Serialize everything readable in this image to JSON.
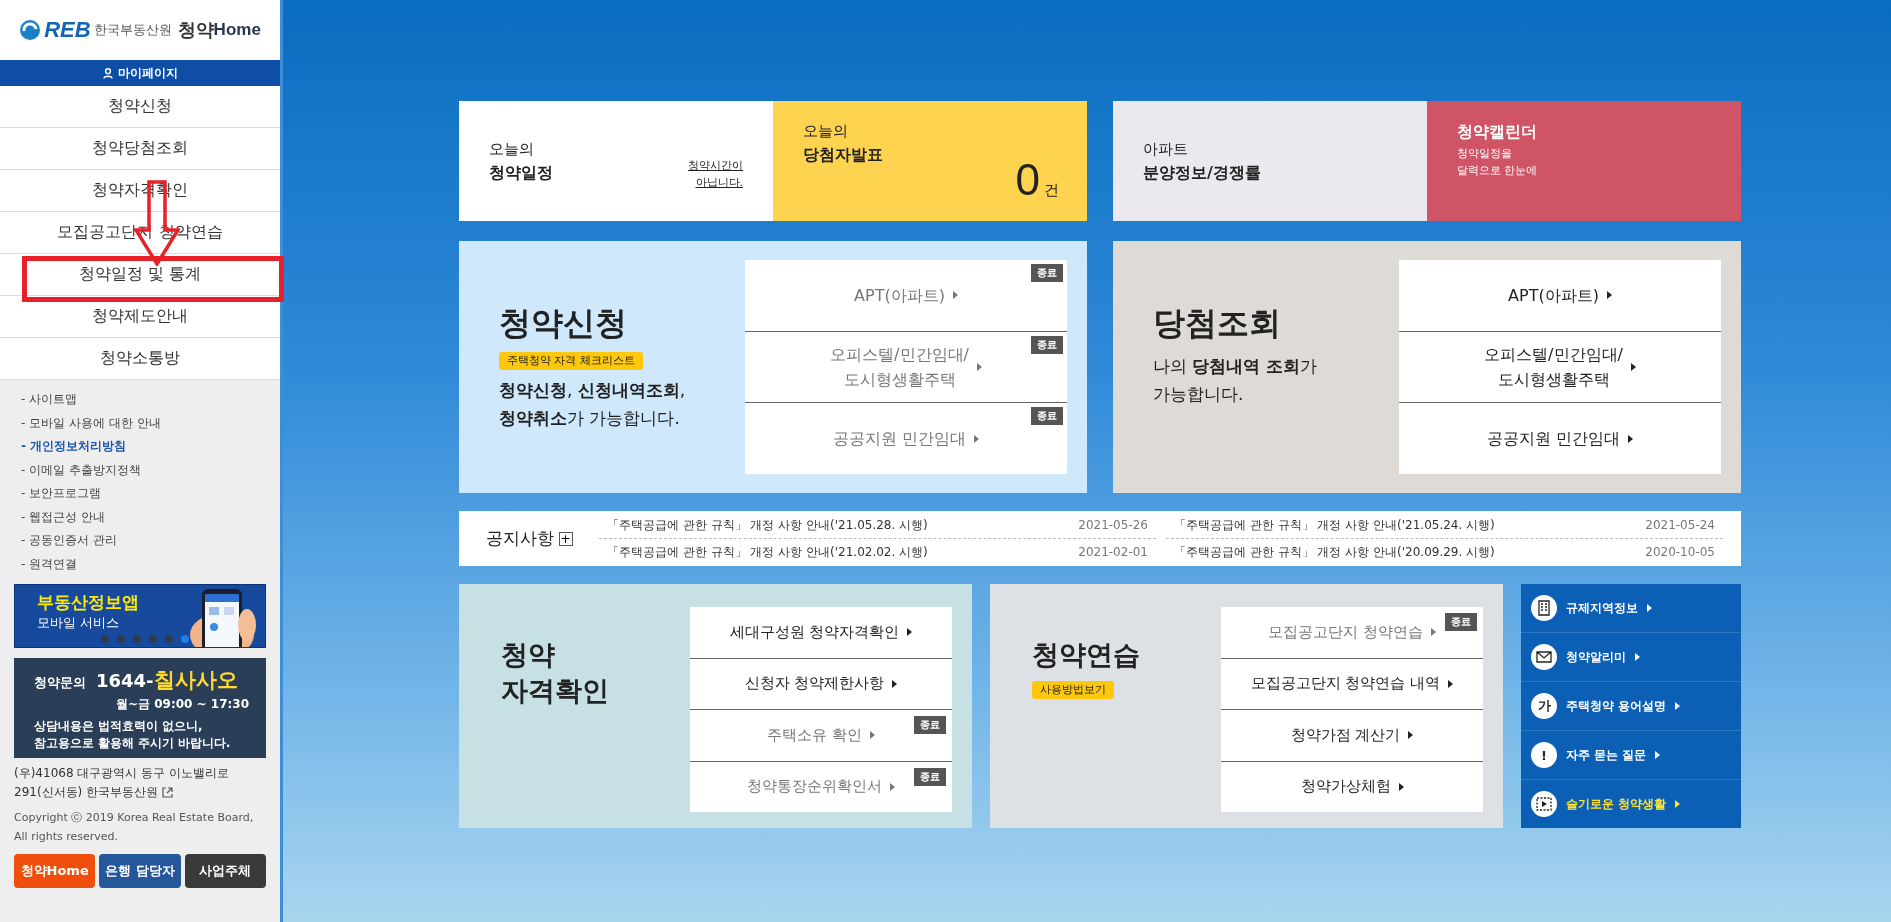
{
  "sidebar": {
    "logo": {
      "mark": "REB",
      "org": "한국부동산원",
      "service": "청약",
      "home": "Home"
    },
    "mypage": "마이페이지",
    "menu": [
      {
        "label": "청약신청",
        "highlighted": false
      },
      {
        "label": "청약당첨조회",
        "highlighted": false
      },
      {
        "label": "청약자격확인",
        "highlighted": false
      },
      {
        "label": "모집공고단지 청약연습",
        "highlighted": false
      },
      {
        "label": "청약일정 및 통계",
        "highlighted": true
      },
      {
        "label": "청약제도안내",
        "highlighted": false
      },
      {
        "label": "청약소통방",
        "highlighted": false
      }
    ],
    "links": [
      {
        "label": "- 사이트맵",
        "highlighted": false
      },
      {
        "label": "- 모바일 사용에 대한 안내",
        "highlighted": false
      },
      {
        "label": "- 개인정보처리방침",
        "highlighted": true
      },
      {
        "label": "- 이메일 추출방지정책",
        "highlighted": false
      },
      {
        "label": "- 보안프로그램",
        "highlighted": false
      },
      {
        "label": "- 웹접근성 안내",
        "highlighted": false
      },
      {
        "label": "- 공동인증서 관리",
        "highlighted": false
      },
      {
        "label": "- 원격연결",
        "highlighted": false
      }
    ],
    "banner": {
      "title": "부동산정보앱",
      "subtitle": "모바일 서비스",
      "slides": [
        {
          "selected": false
        },
        {
          "selected": false
        },
        {
          "selected": false
        },
        {
          "selected": false
        },
        {
          "selected": false
        },
        {
          "selected": true
        }
      ]
    },
    "contact": {
      "label": "청약문의",
      "number": "1644-",
      "number_words": "칠사사오",
      "hours": "월~금 09:00 ~ 17:30",
      "notice": [
        "상담내용은 법적효력이 없으니,",
        "참고용으로 활용해 주시기 바랍니다."
      ]
    },
    "address": [
      "(우)41068 대구광역시 동구 이노밸리로",
      "291(신서동) 한국부동산원"
    ],
    "copyright": "Copyright ⓒ 2019 Korea Real Estate Board, All rights reserved.",
    "buttons": [
      {
        "label": "청약Home",
        "color": "#f04e0c"
      },
      {
        "label": "은행 담당자",
        "color": "#26579a"
      },
      {
        "label": "사업주체",
        "color": "#3a3a3a"
      }
    ],
    "annotation": {
      "arrow": true
    }
  },
  "today": {
    "schedule": {
      "line1": "오늘의",
      "line2": "청약일정",
      "status": "청약시간이 아닙니다."
    },
    "winners": {
      "line1": "오늘의",
      "line2": "당첨자발표",
      "count": "0",
      "unit": "건"
    },
    "apartment": {
      "line1": "아파트",
      "line2": "분양정보/경쟁률"
    },
    "calendar": {
      "title": "청약캘린더",
      "lines": [
        "청약일정을",
        "달력으로 한눈에"
      ]
    }
  },
  "apply": {
    "title": "청약신청",
    "tag": "주택청약 자격 체크리스트",
    "description": [
      "**청약신청**, **신청내역조회**,",
      "**청약취소**가 가능합니다."
    ],
    "items": [
      {
        "lines": [
          "APT(아파트)"
        ],
        "ended": true,
        "badge": "종료"
      },
      {
        "lines": [
          "오피스텔/민간임대/",
          "도시형생활주택"
        ],
        "ended": true,
        "badge": "종료"
      },
      {
        "lines": [
          "공공지원 민간임대"
        ],
        "ended": true,
        "badge": "종료"
      }
    ]
  },
  "results": {
    "title": "당첨조회",
    "description": [
      "나의 **당첨내역 조회**가",
      "가능합니다."
    ],
    "items": [
      {
        "lines": [
          "APT(아파트)"
        ],
        "ended": false
      },
      {
        "lines": [
          "오피스텔/민간임대/",
          "도시형생활주택"
        ],
        "ended": false
      },
      {
        "lines": [
          "공공지원 민간임대"
        ],
        "ended": false
      }
    ]
  },
  "notices": {
    "title": "공지사항",
    "more": "+",
    "items": [
      {
        "text": "「주택공급에 관한 규칙」 개정 사항 안내('21.05.28. 시행)",
        "date": "2021-05-26"
      },
      {
        "text": "「주택공급에 관한 규칙」 개정 사항 안내('21.05.24. 시행)",
        "date": "2021-05-24"
      },
      {
        "text": "「주택공급에 관한 규칙」 개정 사항 안내('21.02.02. 시행)",
        "date": "2021-02-01"
      },
      {
        "text": "「주택공급에 관한 규칙」 개정 사항 안내('20.09.29. 시행)",
        "date": "2020-10-05"
      }
    ]
  },
  "eligibility": {
    "title_lines": [
      "청약",
      "자격확인"
    ],
    "items": [
      {
        "lines": [
          "세대구성원 청약자격확인"
        ],
        "ended": false
      },
      {
        "lines": [
          "신청자 청약제한사항"
        ],
        "ended": false
      },
      {
        "lines": [
          "주택소유 확인"
        ],
        "ended": true,
        "badge": "종료"
      },
      {
        "lines": [
          "청약통장순위확인서"
        ],
        "ended": true,
        "badge": "종료"
      }
    ]
  },
  "practice": {
    "title": "청약연습",
    "tag": "사용방법보기",
    "items": [
      {
        "lines": [
          "모집공고단지 청약연습"
        ],
        "ended": true,
        "badge": "종료"
      },
      {
        "lines": [
          "모집공고단지 청약연습 내역"
        ],
        "ended": false
      },
      {
        "lines": [
          "청약가점 계산기"
        ],
        "ended": false
      },
      {
        "lines": [
          "청약가상체험"
        ],
        "ended": false
      }
    ]
  },
  "quick_links": [
    {
      "kind": "building",
      "label": "규제지역정보",
      "highlighted": false
    },
    {
      "kind": "mail",
      "label": "청약알리미",
      "highlighted": false
    },
    {
      "kind": "char",
      "icon_text": "가",
      "label": "주택청약 용어설명",
      "highlighted": false
    },
    {
      "kind": "char",
      "icon_text": "!",
      "label": "자주 묻는 질문",
      "highlighted": false
    },
    {
      "kind": "play",
      "label": "슬기로운 청약생활",
      "highlighted": true
    }
  ]
}
